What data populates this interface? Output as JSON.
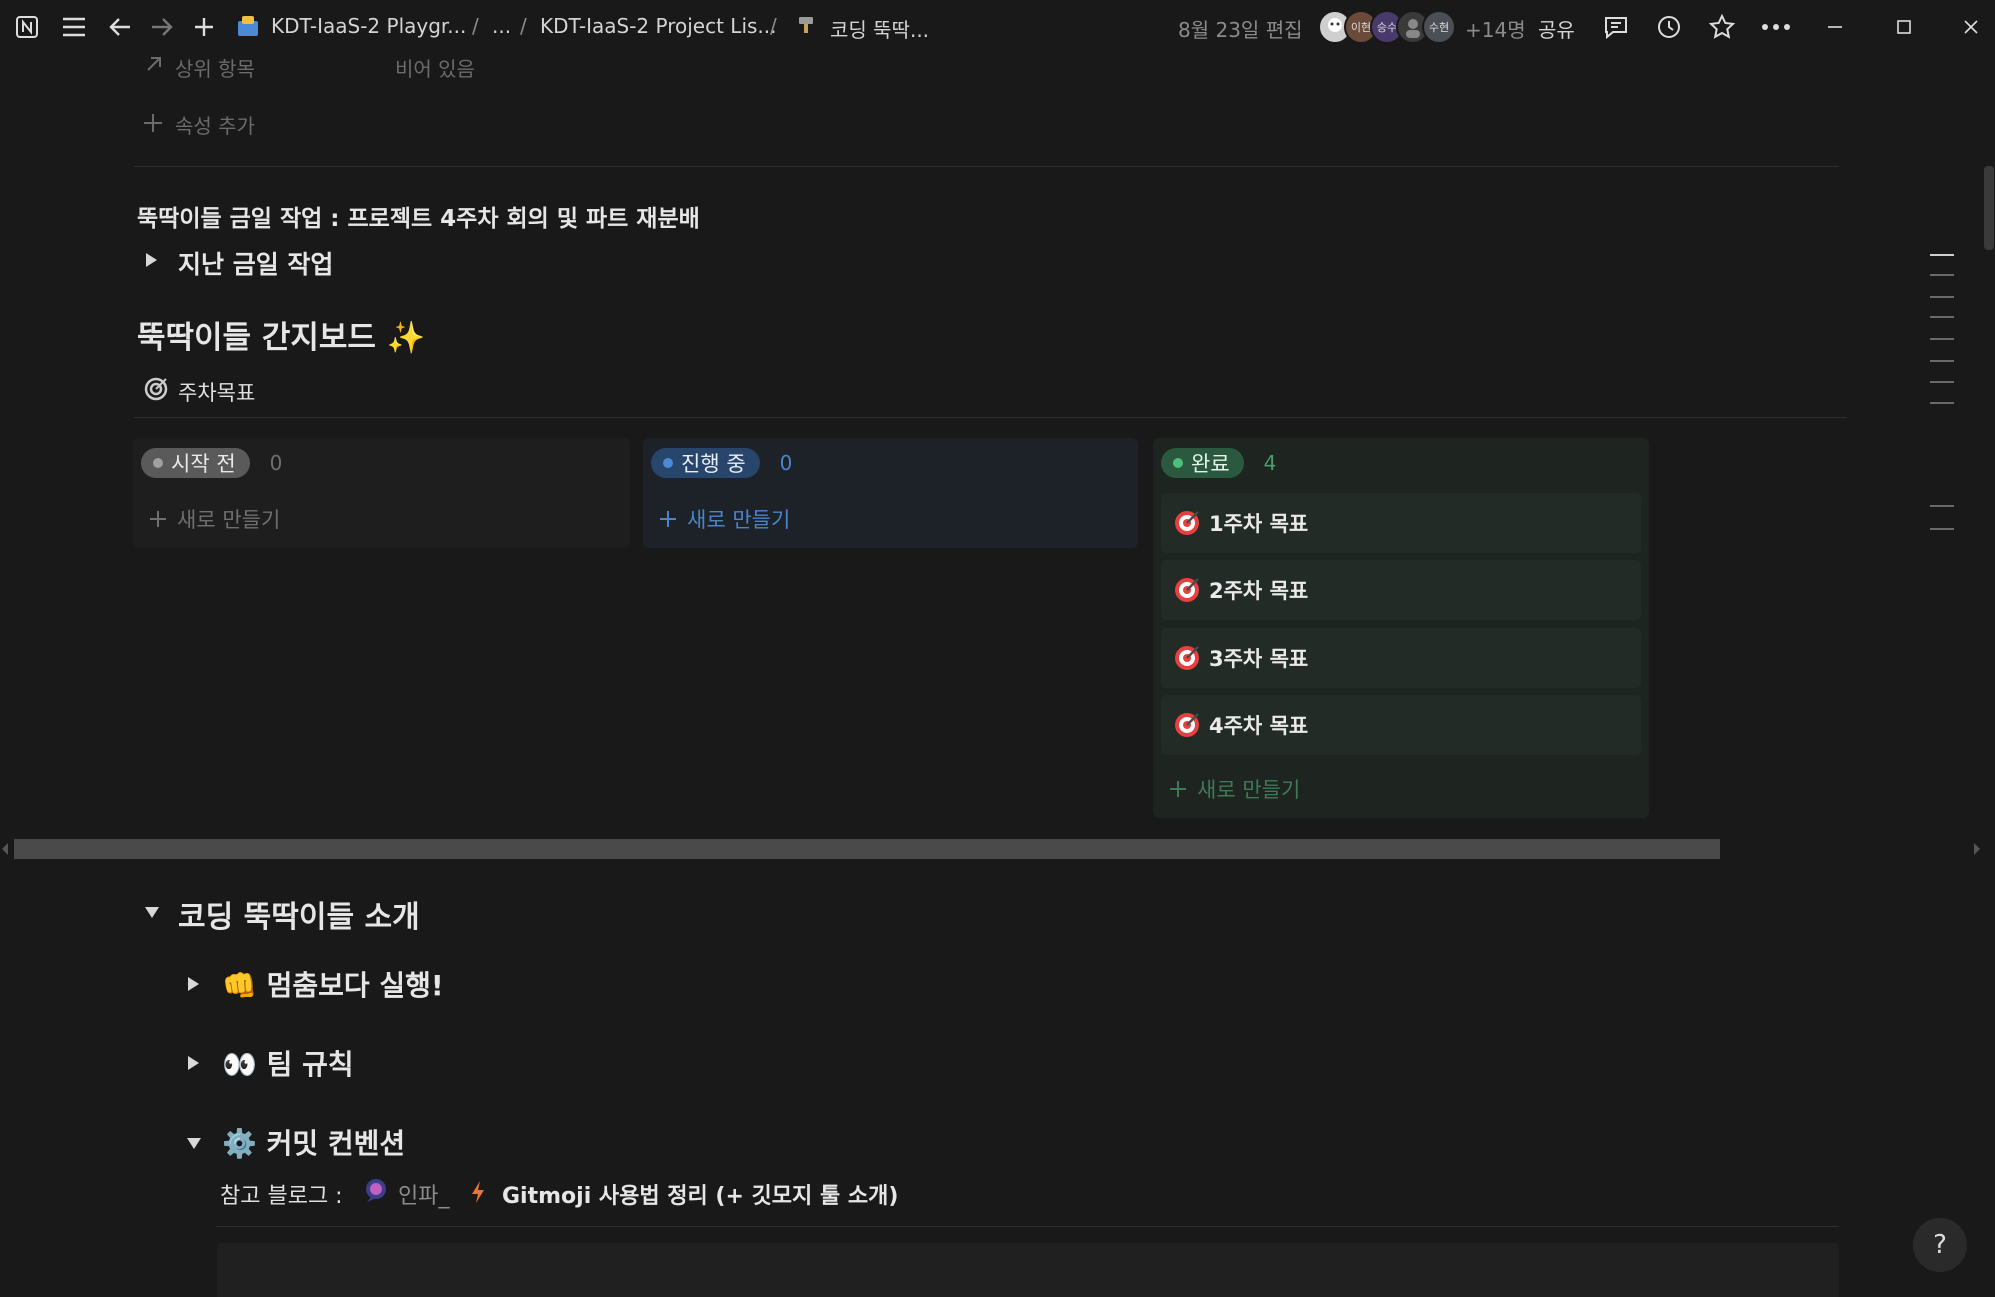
{
  "topbar": {
    "breadcrumb_1": "KDT-IaaS-2 Playgr...",
    "sep": "/",
    "ellipsis": "...",
    "breadcrumb_2": "KDT-IaaS-2 Project Lis...",
    "breadcrumb_3": "코딩 뚝딱...",
    "edited": "8월 23일 편집",
    "avatars": [
      "",
      "이현",
      "승수",
      "",
      "수현"
    ],
    "more_members": "+14명",
    "share": "공유"
  },
  "properties": {
    "parent_label": "상위 항목",
    "parent_value": "비어 있음",
    "add_property": "속성 추가"
  },
  "content": {
    "friday_task": "뚝딱이들 금일 작업 : 프로젝트 4주차 회의 및 파트 재분배",
    "past_task_toggle": "지난 금일 작업",
    "board_heading": "뚝딱이들 간지보드 ✨",
    "view_tab": "주차목표"
  },
  "board": {
    "columns": [
      {
        "label": "시작 전",
        "count": "0",
        "new": "새로 만들기"
      },
      {
        "label": "진행 중",
        "count": "0",
        "new": "새로 만들기"
      },
      {
        "label": "완료",
        "count": "4",
        "new": "새로 만들기",
        "cards": [
          "1주차 목표",
          "2주차 목표",
          "3주차 목표",
          "4주차 목표"
        ]
      }
    ]
  },
  "intro": {
    "title": "코딩 뚝딱이들 소개",
    "item_1": "👊 멈춤보다 실행!",
    "item_2": "👀 팀 규칙",
    "item_3": "⚙️ 커밋 컨벤션",
    "blog_prefix": "참고 블로그 :",
    "blog_author": "인파_",
    "blog_title": "Gitmoji 사용법 정리 (+ 깃모지 툴 소개)"
  },
  "help": "?",
  "colors": {
    "background": "#191919",
    "gray_pill": "#5a5a5a",
    "blue_pill": "#28456c",
    "green_pill": "#2b5940",
    "blue_text": "#4a84c9",
    "green_text": "#4d9c6d"
  }
}
